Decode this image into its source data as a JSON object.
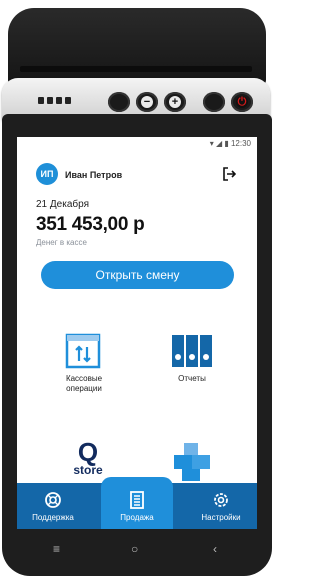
{
  "status_bar": {
    "time": "12:30"
  },
  "user": {
    "initials": "ИП",
    "name": "Иван Петров"
  },
  "balance": {
    "date": "21 Декабря",
    "amount": "351 453,00 р",
    "label": "Денег в кассе"
  },
  "actions": {
    "open_shift": "Открыть смену"
  },
  "tiles": [
    {
      "label_line1": "Кассовые",
      "label_line2": "операции",
      "icon": "cash-operations-icon"
    },
    {
      "label": "Отчеты",
      "icon": "reports-binders-icon"
    },
    {
      "label": "store",
      "logo_letter": "Q",
      "icon": "q-store-logo"
    },
    {
      "icon": "boxes-icon"
    }
  ],
  "nav": {
    "items": [
      {
        "label": "Поддержка",
        "icon": "support-lifebuoy-icon"
      },
      {
        "label": "Продажа",
        "icon": "sale-register-icon",
        "active": true
      },
      {
        "label": "Настройки",
        "icon": "settings-gear-icon"
      }
    ]
  },
  "android_nav": {
    "menu": "≡",
    "home": "○",
    "back": "‹"
  },
  "colors": {
    "accent": "#1f8fda",
    "nav_bg": "#1467a8",
    "power": "#d21a1a"
  }
}
